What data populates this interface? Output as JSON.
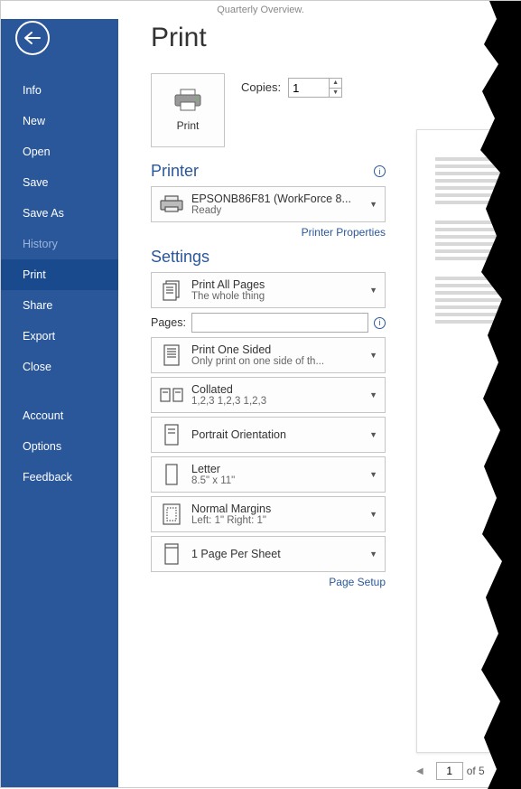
{
  "window": {
    "title": "Quarterly Overview."
  },
  "sidebar": {
    "items": [
      {
        "label": "Info"
      },
      {
        "label": "New"
      },
      {
        "label": "Open"
      },
      {
        "label": "Save"
      },
      {
        "label": "Save As"
      },
      {
        "label": "History"
      },
      {
        "label": "Print"
      },
      {
        "label": "Share"
      },
      {
        "label": "Export"
      },
      {
        "label": "Close"
      },
      {
        "label": "Account"
      },
      {
        "label": "Options"
      },
      {
        "label": "Feedback"
      }
    ]
  },
  "page": {
    "title": "Print",
    "print_label": "Print",
    "copies_label": "Copies:",
    "copies_value": "1"
  },
  "printer": {
    "heading": "Printer",
    "name": "EPSONB86F81 (WorkForce 8...",
    "status": "Ready",
    "properties_link": "Printer Properties"
  },
  "settings": {
    "heading": "Settings",
    "pages_label": "Pages:",
    "pages_value": "",
    "page_setup_link": "Page Setup",
    "items": [
      {
        "line1": "Print All Pages",
        "line2": "The whole thing"
      },
      {
        "line1": "Print One Sided",
        "line2": "Only print on one side of th..."
      },
      {
        "line1": "Collated",
        "line2": "1,2,3    1,2,3    1,2,3"
      },
      {
        "line1": "Portrait Orientation",
        "line2": ""
      },
      {
        "line1": "Letter",
        "line2": "8.5\" x 11\""
      },
      {
        "line1": "Normal Margins",
        "line2": "Left:  1\"    Right:  1\""
      },
      {
        "line1": "1 Page Per Sheet",
        "line2": ""
      }
    ]
  },
  "preview": {
    "current_page": "1",
    "of_label": "of 5"
  }
}
